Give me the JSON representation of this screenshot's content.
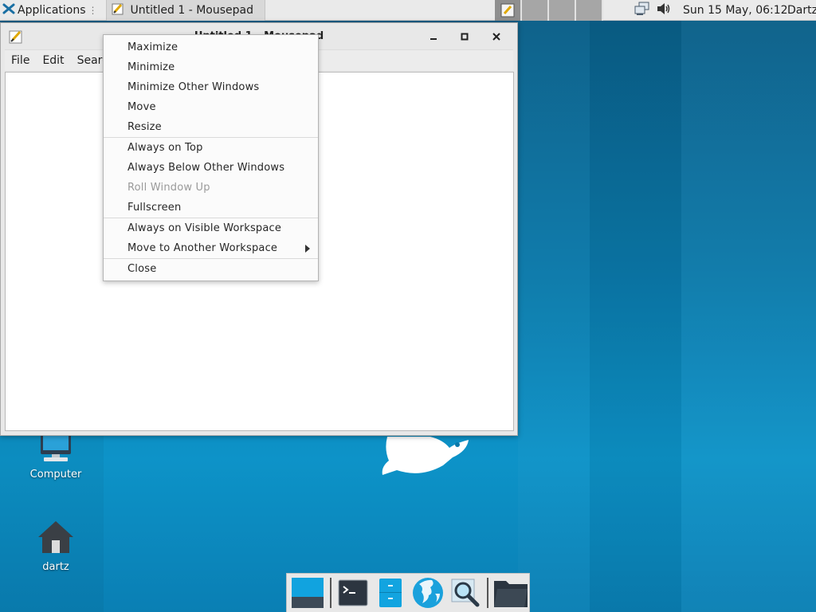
{
  "top_panel": {
    "applications_label": "Applications",
    "applications_separator": "⋮",
    "task_title": "Untitled 1 - Mousepad",
    "clock": "Sun 15 May, 06:12",
    "user": "Dartz"
  },
  "window": {
    "title": "Untitled 1 - Mousepad",
    "menubar": [
      "File",
      "Edit",
      "Search"
    ]
  },
  "context_menu": {
    "groups": [
      [
        {
          "label": "Maximize",
          "enabled": true
        },
        {
          "label": "Minimize",
          "enabled": true
        },
        {
          "label": "Minimize Other Windows",
          "enabled": true
        },
        {
          "label": "Move",
          "enabled": true
        },
        {
          "label": "Resize",
          "enabled": true
        }
      ],
      [
        {
          "label": "Always on Top",
          "enabled": true
        },
        {
          "label": "Always Below Other Windows",
          "enabled": true
        },
        {
          "label": "Roll Window Up",
          "enabled": false
        },
        {
          "label": "Fullscreen",
          "enabled": true
        }
      ],
      [
        {
          "label": "Always on Visible Workspace",
          "enabled": true
        },
        {
          "label": "Move to Another Workspace",
          "enabled": true,
          "submenu": true
        }
      ],
      [
        {
          "label": "Close",
          "enabled": true
        }
      ]
    ]
  },
  "desktop": {
    "icons": [
      "Computer",
      "dartz"
    ]
  },
  "dock": {
    "items": [
      "show-desktop-icon",
      "terminal-icon",
      "file-manager-icon",
      "web-browser-icon",
      "app-finder-icon",
      "folder-icon"
    ]
  },
  "colors": {
    "desktop_blue": "#0b79aa",
    "panel_gray": "#eaeaea",
    "menu_bg": "#fbfbfb",
    "disabled_text": "#9a9a9a"
  }
}
